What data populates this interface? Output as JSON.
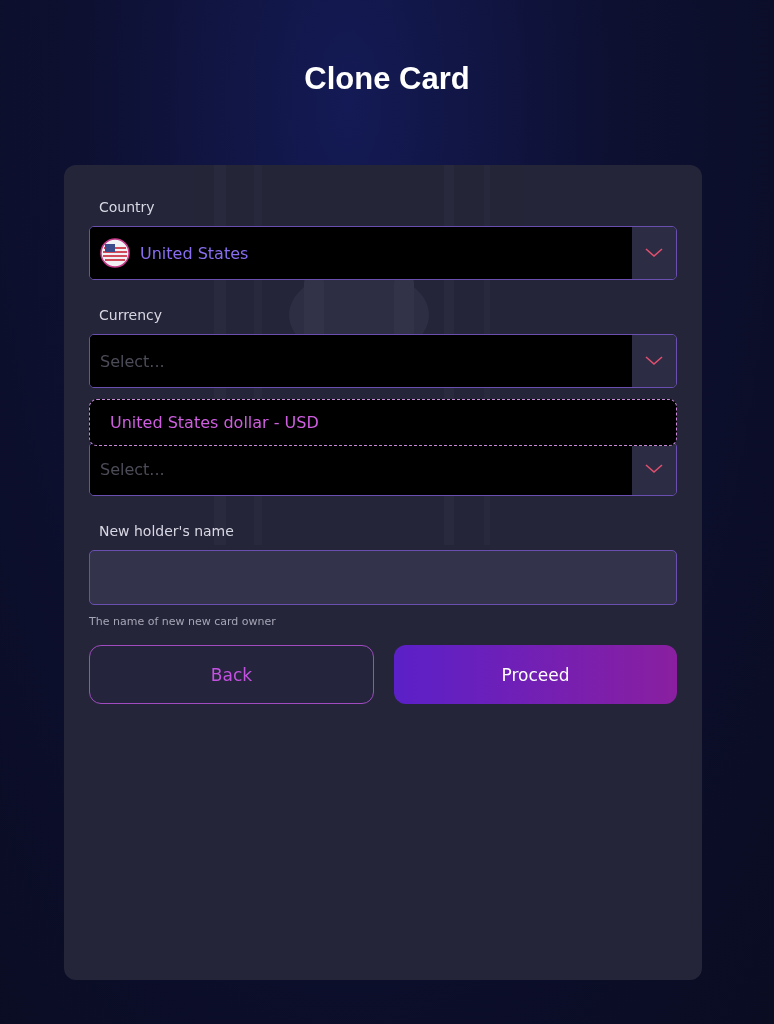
{
  "title": "Clone Card",
  "fields": [
    {
      "kind": "select",
      "label": "Country",
      "value": "United States",
      "flag": true
    },
    {
      "kind": "select",
      "label": "Currency",
      "placeholder": "Select...",
      "open": true,
      "options": [
        "United States dollar - USD"
      ]
    },
    {
      "kind": "select",
      "placeholder": "Select..."
    },
    {
      "kind": "text",
      "label": "New holder's name",
      "hint": "The name of new new card owner"
    }
  ],
  "buttons": [
    {
      "kind": "secondary",
      "label": "Back"
    },
    {
      "kind": "primary",
      "label": "Proceed"
    }
  ]
}
